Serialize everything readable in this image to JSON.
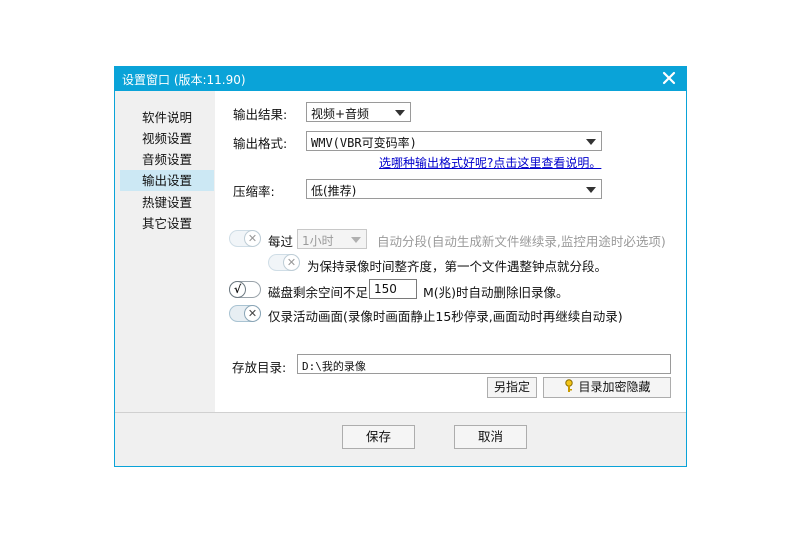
{
  "window": {
    "title": "设置窗口 (版本:11.90)"
  },
  "sidebar": {
    "items": [
      {
        "label": "软件说明"
      },
      {
        "label": "视频设置"
      },
      {
        "label": "音频设置"
      },
      {
        "label": "输出设置",
        "active": true
      },
      {
        "label": "热键设置"
      },
      {
        "label": "其它设置"
      }
    ]
  },
  "output": {
    "result_label": "输出结果:",
    "result_value": "视频+音频",
    "format_label": "输出格式:",
    "format_value": "WMV(VBR可变码率)",
    "format_help_link": "选哪种输出格式好呢?点击这里查看说明。",
    "compress_label": "压缩率:",
    "compress_value": "低(推荐)"
  },
  "segment": {
    "each_label": "每过",
    "interval_value": "1小时",
    "auto_text": "自动分段(自动生成新文件继续录,监控用途时必选项)",
    "align_text": "为保持录像时间整齐度，第一个文件遇整钟点就分段。"
  },
  "disk": {
    "prefix": "磁盘剩余空间不足",
    "value": "150",
    "suffix": "M(兆)时自动删除旧录像。"
  },
  "active_only": {
    "text": "仅录活动画面(录像时画面静止15秒停录,画面动时再继续自动录)"
  },
  "storage": {
    "label": "存放目录:",
    "path": "D:\\我的录像",
    "specify_button": "另指定",
    "encrypt_button": "目录加密隐藏"
  },
  "footer": {
    "save": "保存",
    "cancel": "取消"
  },
  "icons": {
    "close": "close-icon",
    "toggle_off": "x-mark-icon",
    "toggle_on": "check-mark-icon",
    "key": "key-icon"
  },
  "colors": {
    "titlebar": "#0aa3d8",
    "active_item": "#cce8f4",
    "link": "#0000cc"
  }
}
